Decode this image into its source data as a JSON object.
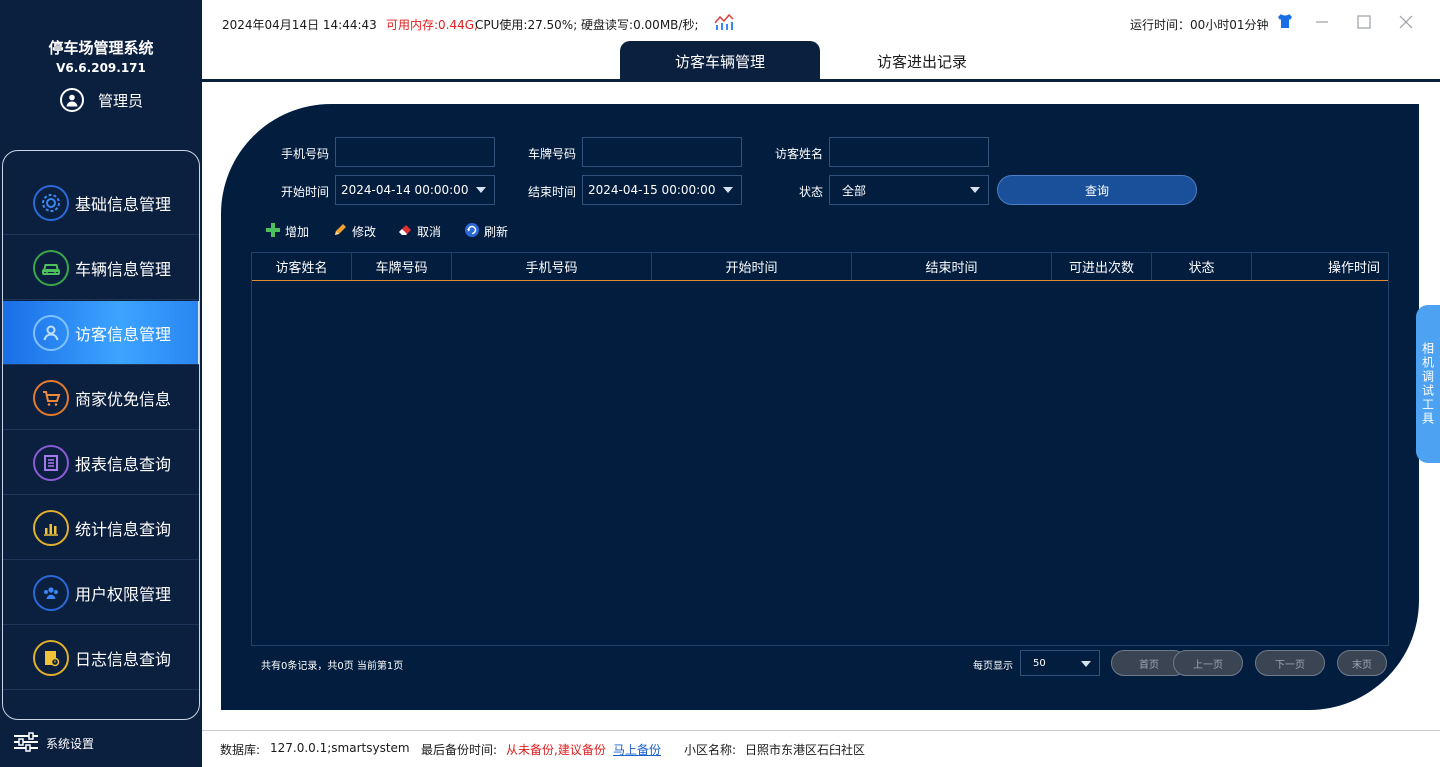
{
  "app": {
    "title": "停车场管理系统",
    "version": "V6.6.209.171",
    "user": "管理员"
  },
  "nav": {
    "items": [
      {
        "label": "基础信息管理",
        "icon": "gear-icon",
        "color": "#2a6ad8"
      },
      {
        "label": "车辆信息管理",
        "icon": "car-icon",
        "color": "#3aa64a"
      },
      {
        "label": "访客信息管理",
        "icon": "visitor-icon",
        "color": "#7fc2ff",
        "active": true
      },
      {
        "label": "商家优免信息",
        "icon": "cart-icon",
        "color": "#e07a2c"
      },
      {
        "label": "报表信息查询",
        "icon": "report-icon",
        "color": "#8b5bd6"
      },
      {
        "label": "统计信息查询",
        "icon": "stats-icon",
        "color": "#e0b02c"
      },
      {
        "label": "用户权限管理",
        "icon": "users-icon",
        "color": "#2a6ad8"
      },
      {
        "label": "日志信息查询",
        "icon": "log-icon",
        "color": "#e0b02c"
      }
    ],
    "settings_label": "系统设置"
  },
  "topbar": {
    "datetime": "2024年04月14日 14:44:43",
    "memory": "可用内存:0.44G;",
    "cpu_disk": "CPU使用:27.50%; 硬盘读写:0.00MB/秒;",
    "runtime": "运行时间：00小时01分钟"
  },
  "tabs": [
    {
      "label": "访客车辆管理",
      "active": true
    },
    {
      "label": "访客进出记录",
      "active": false
    }
  ],
  "filters": {
    "phone_label": "手机号码",
    "phone_value": "",
    "plate_label": "车牌号码",
    "plate_value": "",
    "name_label": "访客姓名",
    "name_value": "",
    "start_label": "开始时间",
    "start_value": "2024-04-14 00:00:00",
    "end_label": "结束时间",
    "end_value": "2024-04-15 00:00:00",
    "status_label": "状态",
    "status_value": "全部",
    "query_label": "查询"
  },
  "toolbar": {
    "add": "增加",
    "edit": "修改",
    "cancel": "取消",
    "refresh": "刷新"
  },
  "table": {
    "columns": [
      "访客姓名",
      "车牌号码",
      "手机号码",
      "开始时间",
      "结束时间",
      "可进出次数",
      "状态",
      "操作时间"
    ],
    "rows": []
  },
  "pager": {
    "info": "共有0条记录，共0页 当前第1页",
    "per_page_label": "每页显示",
    "per_page_value": "50",
    "first": "首页",
    "prev": "上一页",
    "next": "下一页",
    "last": "末页"
  },
  "side_tool": {
    "label": "相机调试工具"
  },
  "statusbar": {
    "db_label": "数据库:",
    "db_value": "127.0.0.1;smartsystem",
    "backup_label": "最后备份时间:",
    "backup_value": "从未备份,建议备份",
    "backup_link": "马上备份",
    "community_label": "小区名称:",
    "community_value": "日照市东港区石臼社区"
  },
  "colors": {
    "sidebar_bg": "#0b1f3f",
    "panel_bg": "#031d3f",
    "active_nav": "#2a86f2",
    "warning_text": "#e02020",
    "link": "#1a5fcc",
    "grid_header_rule": "#e08a2c"
  }
}
